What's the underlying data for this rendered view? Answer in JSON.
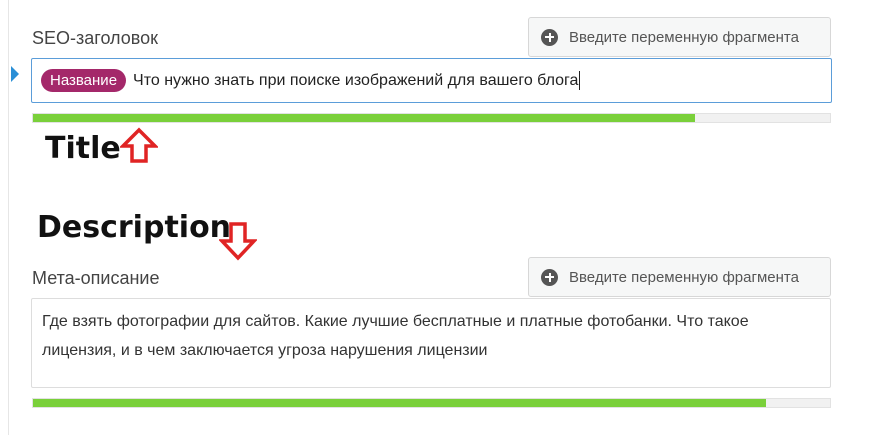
{
  "seo_title": {
    "label": "SEO-заголовок",
    "insert_button": "Введите переменную фрагмента",
    "pill": "Название",
    "value": "Что нужно знать при поиске изображений для вашего блога",
    "progress": 0.83
  },
  "meta_description": {
    "label": "Мета-описание",
    "insert_button": "Введите переменную фрагмента",
    "value": "Где взять фотографии для сайтов. Какие лучшие бесплатные и платные фотобанки. Что такое лицензия, и в чем заключается угроза нарушения лицензии",
    "progress": 0.92
  },
  "annotations": {
    "title": "Title",
    "description": "Description"
  },
  "colors": {
    "pill": "#a4286a",
    "progress_good": "#7ad03a",
    "arrow": "#e02424",
    "focus_border": "#5b9dd9"
  },
  "icons": {
    "insert": "plus-circle-icon",
    "collapse": "caret-right-icon",
    "annotation_up": "arrow-up-icon",
    "annotation_down": "arrow-down-icon"
  }
}
